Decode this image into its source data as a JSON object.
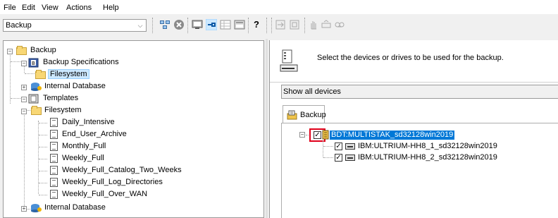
{
  "menu": [
    "File",
    "Edit",
    "View",
    "Actions",
    "Help"
  ],
  "toolbar": {
    "context_value": "Backup",
    "icons": [
      "clients-icon",
      "cancel-icon",
      "monitor-icon",
      "pin-icon",
      "grid-icon",
      "report-icon",
      "help-icon",
      "wizard-icon",
      "refresh-icon",
      "hand-icon",
      "disk-icon",
      "tape-icon"
    ]
  },
  "tree": {
    "root": "Backup",
    "backup_specifications": "Backup Specifications",
    "spec_filesystem": "Filesystem",
    "spec_internal_db": "Internal Database",
    "templates": "Templates",
    "tpl_filesystem": "Filesystem",
    "items": [
      "Daily_Intensive",
      "End_User_Archive",
      "Monthly_Full",
      "Weekly_Full",
      "Weekly_Full_Catalog_Two_Weeks",
      "Weekly_Full_Log_Directories",
      "Weekly_Full_Over_WAN"
    ],
    "tpl_internal_db": "Internal Database"
  },
  "right": {
    "instruction": "Select the devices or drives to be used for the backup.",
    "filter": "Show all devices",
    "tab": "Backup",
    "devices": {
      "library": "BDT:MULTISTAK_sd32128win2019",
      "drives": [
        "IBM:ULTRIUM-HH8_1_sd32128win2019",
        "IBM:ULTRIUM-HH8_2_sd32128win2019"
      ]
    }
  },
  "colors": {
    "selection": "#0078d7",
    "highlight_box": "#e0001a"
  }
}
